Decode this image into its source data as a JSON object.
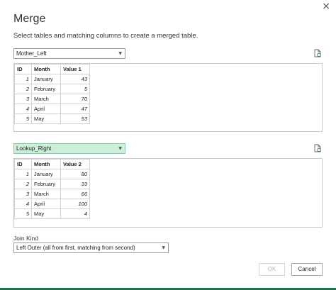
{
  "dialog": {
    "title": "Merge",
    "subtitle": "Select tables and matching columns to create a merged table.",
    "close_glyph": "×"
  },
  "first_table": {
    "selected": "Mother_Left",
    "columns": [
      "ID",
      "Month",
      "Value 1"
    ],
    "rows": [
      [
        "1",
        "January",
        "43"
      ],
      [
        "2",
        "February",
        "5"
      ],
      [
        "3",
        "March",
        "70"
      ],
      [
        "4",
        "April",
        "47"
      ],
      [
        "5",
        "May",
        "53"
      ]
    ]
  },
  "second_table": {
    "selected": "Lookup_Right",
    "columns": [
      "ID",
      "Month",
      "Value 2"
    ],
    "rows": [
      [
        "1",
        "January",
        "80"
      ],
      [
        "2",
        "February",
        "33"
      ],
      [
        "3",
        "March",
        "66"
      ],
      [
        "4",
        "April",
        "100"
      ],
      [
        "5",
        "May",
        "4"
      ]
    ]
  },
  "join": {
    "label": "Join Kind",
    "selected": "Left Outer (all from first, matching from second)"
  },
  "buttons": {
    "ok": "OK",
    "cancel": "Cancel"
  },
  "colors": {
    "accent": "#217346",
    "selected_combo": "#cdeed9"
  },
  "icons": {
    "preview": "refresh-preview-icon",
    "dropdown": "chevron-down-icon",
    "close": "close-icon"
  }
}
